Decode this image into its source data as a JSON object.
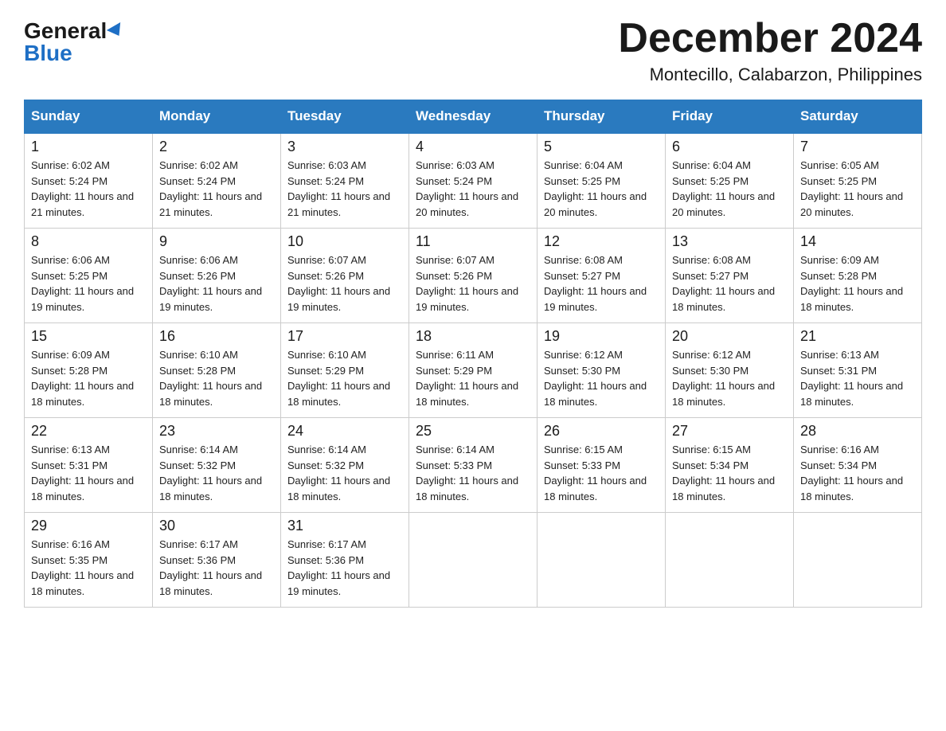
{
  "logo": {
    "general": "General",
    "blue": "Blue"
  },
  "title": {
    "month_year": "December 2024",
    "location": "Montecillo, Calabarzon, Philippines"
  },
  "headers": [
    "Sunday",
    "Monday",
    "Tuesday",
    "Wednesday",
    "Thursday",
    "Friday",
    "Saturday"
  ],
  "weeks": [
    [
      {
        "day": "1",
        "sunrise": "Sunrise: 6:02 AM",
        "sunset": "Sunset: 5:24 PM",
        "daylight": "Daylight: 11 hours and 21 minutes."
      },
      {
        "day": "2",
        "sunrise": "Sunrise: 6:02 AM",
        "sunset": "Sunset: 5:24 PM",
        "daylight": "Daylight: 11 hours and 21 minutes."
      },
      {
        "day": "3",
        "sunrise": "Sunrise: 6:03 AM",
        "sunset": "Sunset: 5:24 PM",
        "daylight": "Daylight: 11 hours and 21 minutes."
      },
      {
        "day": "4",
        "sunrise": "Sunrise: 6:03 AM",
        "sunset": "Sunset: 5:24 PM",
        "daylight": "Daylight: 11 hours and 20 minutes."
      },
      {
        "day": "5",
        "sunrise": "Sunrise: 6:04 AM",
        "sunset": "Sunset: 5:25 PM",
        "daylight": "Daylight: 11 hours and 20 minutes."
      },
      {
        "day": "6",
        "sunrise": "Sunrise: 6:04 AM",
        "sunset": "Sunset: 5:25 PM",
        "daylight": "Daylight: 11 hours and 20 minutes."
      },
      {
        "day": "7",
        "sunrise": "Sunrise: 6:05 AM",
        "sunset": "Sunset: 5:25 PM",
        "daylight": "Daylight: 11 hours and 20 minutes."
      }
    ],
    [
      {
        "day": "8",
        "sunrise": "Sunrise: 6:06 AM",
        "sunset": "Sunset: 5:25 PM",
        "daylight": "Daylight: 11 hours and 19 minutes."
      },
      {
        "day": "9",
        "sunrise": "Sunrise: 6:06 AM",
        "sunset": "Sunset: 5:26 PM",
        "daylight": "Daylight: 11 hours and 19 minutes."
      },
      {
        "day": "10",
        "sunrise": "Sunrise: 6:07 AM",
        "sunset": "Sunset: 5:26 PM",
        "daylight": "Daylight: 11 hours and 19 minutes."
      },
      {
        "day": "11",
        "sunrise": "Sunrise: 6:07 AM",
        "sunset": "Sunset: 5:26 PM",
        "daylight": "Daylight: 11 hours and 19 minutes."
      },
      {
        "day": "12",
        "sunrise": "Sunrise: 6:08 AM",
        "sunset": "Sunset: 5:27 PM",
        "daylight": "Daylight: 11 hours and 19 minutes."
      },
      {
        "day": "13",
        "sunrise": "Sunrise: 6:08 AM",
        "sunset": "Sunset: 5:27 PM",
        "daylight": "Daylight: 11 hours and 18 minutes."
      },
      {
        "day": "14",
        "sunrise": "Sunrise: 6:09 AM",
        "sunset": "Sunset: 5:28 PM",
        "daylight": "Daylight: 11 hours and 18 minutes."
      }
    ],
    [
      {
        "day": "15",
        "sunrise": "Sunrise: 6:09 AM",
        "sunset": "Sunset: 5:28 PM",
        "daylight": "Daylight: 11 hours and 18 minutes."
      },
      {
        "day": "16",
        "sunrise": "Sunrise: 6:10 AM",
        "sunset": "Sunset: 5:28 PM",
        "daylight": "Daylight: 11 hours and 18 minutes."
      },
      {
        "day": "17",
        "sunrise": "Sunrise: 6:10 AM",
        "sunset": "Sunset: 5:29 PM",
        "daylight": "Daylight: 11 hours and 18 minutes."
      },
      {
        "day": "18",
        "sunrise": "Sunrise: 6:11 AM",
        "sunset": "Sunset: 5:29 PM",
        "daylight": "Daylight: 11 hours and 18 minutes."
      },
      {
        "day": "19",
        "sunrise": "Sunrise: 6:12 AM",
        "sunset": "Sunset: 5:30 PM",
        "daylight": "Daylight: 11 hours and 18 minutes."
      },
      {
        "day": "20",
        "sunrise": "Sunrise: 6:12 AM",
        "sunset": "Sunset: 5:30 PM",
        "daylight": "Daylight: 11 hours and 18 minutes."
      },
      {
        "day": "21",
        "sunrise": "Sunrise: 6:13 AM",
        "sunset": "Sunset: 5:31 PM",
        "daylight": "Daylight: 11 hours and 18 minutes."
      }
    ],
    [
      {
        "day": "22",
        "sunrise": "Sunrise: 6:13 AM",
        "sunset": "Sunset: 5:31 PM",
        "daylight": "Daylight: 11 hours and 18 minutes."
      },
      {
        "day": "23",
        "sunrise": "Sunrise: 6:14 AM",
        "sunset": "Sunset: 5:32 PM",
        "daylight": "Daylight: 11 hours and 18 minutes."
      },
      {
        "day": "24",
        "sunrise": "Sunrise: 6:14 AM",
        "sunset": "Sunset: 5:32 PM",
        "daylight": "Daylight: 11 hours and 18 minutes."
      },
      {
        "day": "25",
        "sunrise": "Sunrise: 6:14 AM",
        "sunset": "Sunset: 5:33 PM",
        "daylight": "Daylight: 11 hours and 18 minutes."
      },
      {
        "day": "26",
        "sunrise": "Sunrise: 6:15 AM",
        "sunset": "Sunset: 5:33 PM",
        "daylight": "Daylight: 11 hours and 18 minutes."
      },
      {
        "day": "27",
        "sunrise": "Sunrise: 6:15 AM",
        "sunset": "Sunset: 5:34 PM",
        "daylight": "Daylight: 11 hours and 18 minutes."
      },
      {
        "day": "28",
        "sunrise": "Sunrise: 6:16 AM",
        "sunset": "Sunset: 5:34 PM",
        "daylight": "Daylight: 11 hours and 18 minutes."
      }
    ],
    [
      {
        "day": "29",
        "sunrise": "Sunrise: 6:16 AM",
        "sunset": "Sunset: 5:35 PM",
        "daylight": "Daylight: 11 hours and 18 minutes."
      },
      {
        "day": "30",
        "sunrise": "Sunrise: 6:17 AM",
        "sunset": "Sunset: 5:36 PM",
        "daylight": "Daylight: 11 hours and 18 minutes."
      },
      {
        "day": "31",
        "sunrise": "Sunrise: 6:17 AM",
        "sunset": "Sunset: 5:36 PM",
        "daylight": "Daylight: 11 hours and 19 minutes."
      },
      {
        "day": "",
        "sunrise": "",
        "sunset": "",
        "daylight": ""
      },
      {
        "day": "",
        "sunrise": "",
        "sunset": "",
        "daylight": ""
      },
      {
        "day": "",
        "sunrise": "",
        "sunset": "",
        "daylight": ""
      },
      {
        "day": "",
        "sunrise": "",
        "sunset": "",
        "daylight": ""
      }
    ]
  ]
}
